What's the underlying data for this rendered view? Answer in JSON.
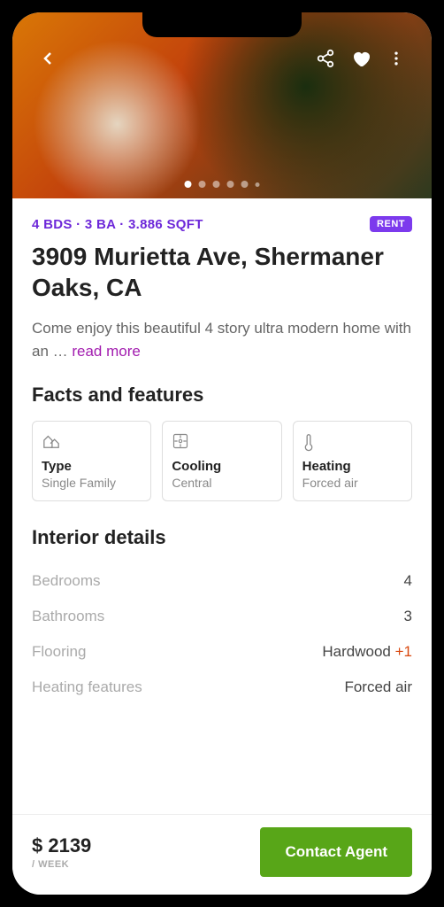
{
  "stats": "4 BDS · 3 BA · 3.886 SQFT",
  "badge": "RENT",
  "title": "3909 Murietta Ave, Shermaner Oaks, CA",
  "description": "Come enjoy this beautiful 4 story ultra modern home with an … ",
  "read_more": "read more",
  "facts_heading": "Facts and features",
  "features": [
    {
      "label": "Type",
      "value": "Single Family"
    },
    {
      "label": "Cooling",
      "value": "Central"
    },
    {
      "label": "Heating",
      "value": "Forced air"
    }
  ],
  "interior_heading": "Interior details",
  "interior": [
    {
      "label": "Bedrooms",
      "value": "4",
      "extra": ""
    },
    {
      "label": "Bathrooms",
      "value": "3",
      "extra": ""
    },
    {
      "label": "Flooring",
      "value": "Hardwood ",
      "extra": "+1"
    },
    {
      "label": "Heating features",
      "value": "Forced air",
      "extra": ""
    }
  ],
  "price": "$ 2139",
  "period": "/ WEEK",
  "cta": "Contact Agent",
  "carousel": {
    "count": 6,
    "active": 0
  }
}
